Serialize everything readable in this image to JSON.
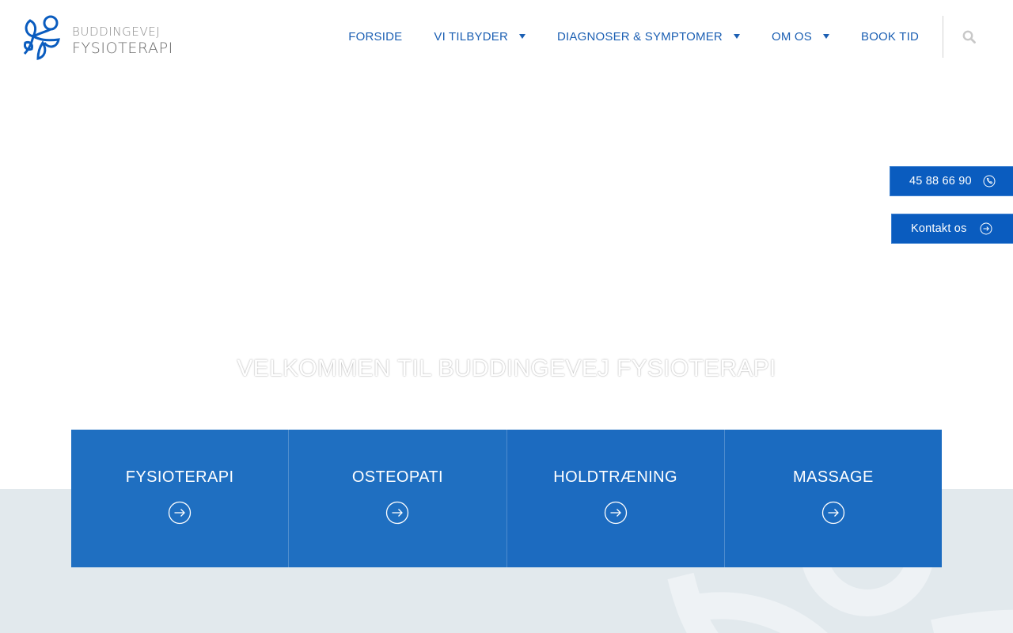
{
  "brand": {
    "line1": "BUDDINGEVEJ",
    "line2": "FYSIOTERAPI",
    "color": "#0a5cbf"
  },
  "nav": {
    "items": [
      {
        "label": "FORSIDE",
        "dropdown": false
      },
      {
        "label": "VI TILBYDER",
        "dropdown": true
      },
      {
        "label": "DIAGNOSER & SYMPTOMER",
        "dropdown": true
      },
      {
        "label": "OM OS",
        "dropdown": true
      },
      {
        "label": "BOOK TID",
        "dropdown": false
      }
    ],
    "search_icon": "search-icon"
  },
  "hero": {
    "title": "VELKOMMEN TIL BUDDINGEVEJ FYSIOTERAPI"
  },
  "side_buttons": {
    "phone": {
      "label": "45 88 66 90",
      "icon": "phone-icon"
    },
    "contact": {
      "label": "Kontakt os",
      "icon": "arrow-circle-icon"
    }
  },
  "services": [
    {
      "title": "FYSIOTERAPI",
      "icon": "arrow-circle-icon"
    },
    {
      "title": "OSTEOPATI",
      "icon": "arrow-circle-icon"
    },
    {
      "title": "HOLDTRÆNING",
      "icon": "arrow-circle-icon"
    },
    {
      "title": "MASSAGE",
      "icon": "arrow-circle-icon"
    }
  ],
  "colors": {
    "primary": "#0a5cbf",
    "nav_text": "#1b5fb3",
    "card": "#1f6fc1",
    "lower_background": "#e2e9ed"
  }
}
